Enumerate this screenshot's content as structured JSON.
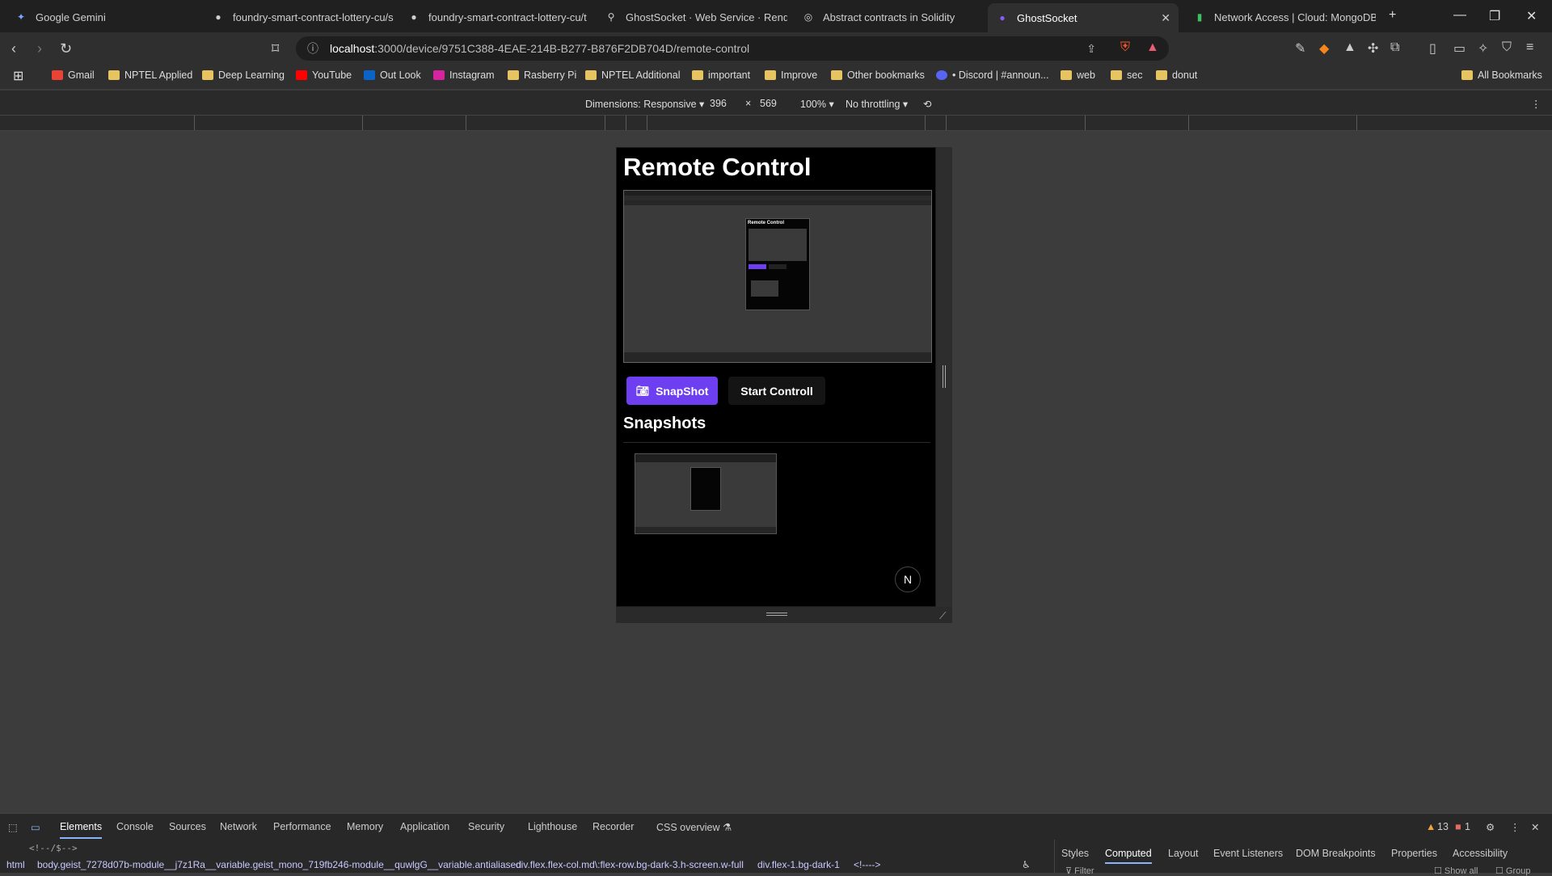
{
  "tabs": [
    {
      "title": "Google Gemini",
      "icon": "gemini-icon"
    },
    {
      "title": "foundry-smart-contract-lottery-cu/s",
      "icon": "github-icon"
    },
    {
      "title": "foundry-smart-contract-lottery-cu/t",
      "icon": "github-icon"
    },
    {
      "title": "GhostSocket · Web Service · Render",
      "icon": "render-icon"
    },
    {
      "title": "Abstract contracts in Solidity",
      "icon": "globe-icon"
    },
    {
      "title": "GhostSocket",
      "icon": "ghost-icon",
      "active": true
    },
    {
      "title": "Network Access | Cloud: MongoDB C",
      "icon": "mongodb-icon"
    }
  ],
  "address": {
    "host": "localhost",
    "path": ":3000/device/9751C388-4EAE-214B-B277-B876F2DB704D/remote-control"
  },
  "bookmarks": [
    {
      "label": "Gmail",
      "type": "site"
    },
    {
      "label": "NPTEL Applied",
      "type": "folder"
    },
    {
      "label": "Deep Learning",
      "type": "folder"
    },
    {
      "label": "YouTube",
      "type": "site"
    },
    {
      "label": "Out Look",
      "type": "site"
    },
    {
      "label": "Instagram",
      "type": "site"
    },
    {
      "label": "Rasberry Pi",
      "type": "folder"
    },
    {
      "label": "NPTEL Additional",
      "type": "folder"
    },
    {
      "label": "important",
      "type": "folder"
    },
    {
      "label": "Improve",
      "type": "folder"
    },
    {
      "label": "Other bookmarks",
      "type": "folder"
    },
    {
      "label": "• Discord | #announ...",
      "type": "site"
    },
    {
      "label": "web",
      "type": "folder"
    },
    {
      "label": "sec",
      "type": "folder"
    },
    {
      "label": "donut",
      "type": "folder"
    }
  ],
  "all_bookmarks": "All Bookmarks",
  "device_toolbar": {
    "dimensions": "Dimensions: Responsive ▾",
    "width": "396",
    "times": "×",
    "height": "569",
    "zoom": "100% ▾",
    "throttling": "No throttling ▾"
  },
  "page": {
    "heading": "Remote Control",
    "mini_heading": "Remote Control",
    "snapshot_button": "SnapShot",
    "control_button": "Start Controll",
    "snapshots_heading": "Snapshots",
    "badge": "N"
  },
  "devtools": {
    "tabs": [
      "Elements",
      "Console",
      "Sources",
      "Network",
      "Performance",
      "Memory",
      "Application",
      "Security",
      "Lighthouse",
      "Recorder",
      "CSS overview ⚗"
    ],
    "warnings": "13",
    "errors": "1",
    "code_line": "<!--/$-->",
    "breadcrumbs": [
      "html",
      "body.geist_7278d07b-module__j7z1Ra__variable.geist_mono_719fb246-module__quwlgG__variable.antialiased",
      "div.flex.flex-col.md\\:flex-row.bg-dark-3.h-screen.w-full",
      "div.flex-1.bg-dark-1",
      "<!---->"
    ],
    "side_tabs": [
      "Styles",
      "Computed",
      "Layout",
      "Event Listeners",
      "DOM Breakpoints",
      "Properties",
      "Accessibility"
    ],
    "filter_placeholder": "Filter",
    "show_all": "Show all",
    "group": "Group"
  }
}
